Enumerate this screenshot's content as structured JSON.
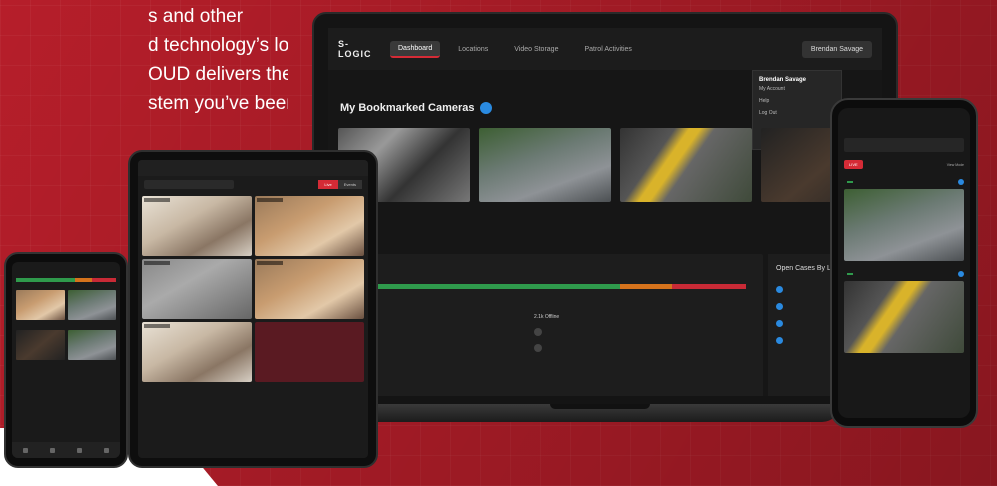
{
  "marketing": {
    "lines": [
      "s and other",
      "d technology’s low",
      "OUD delivers the",
      "stem you’ve been"
    ]
  },
  "colors": {
    "brand_red": "#b61e2a",
    "accent_red": "#d52b36",
    "online_green": "#2f9a4c",
    "warning_orange": "#d6731c",
    "info_blue": "#2a8ae0"
  },
  "laptop": {
    "nav": {
      "logo": "S-LOGIC",
      "items": [
        "Dashboard",
        "Locations",
        "Video Storage",
        "Patrol Activities"
      ],
      "user_chip": "Brendan Savage"
    },
    "user_menu": {
      "name": "Brendan Savage",
      "items": [
        "My Account",
        "Help",
        "Log Out"
      ]
    },
    "bookmarked_title": "My Bookmarked Cameras",
    "cameras": [
      {
        "label": "",
        "sub": "",
        "status": ""
      },
      {
        "label": "",
        "sub": "",
        "status": ""
      },
      {
        "label": "",
        "sub": "",
        "status": ""
      },
      {
        "label": "",
        "sub": "",
        "status": ""
      }
    ],
    "status_panel": {
      "offline_title": "2.1k Offline"
    },
    "side_panel": {
      "title": "Open Cases By Location"
    }
  },
  "tablet": {
    "toggle": [
      "Live",
      "Events"
    ]
  },
  "phone_right": {
    "loc": "",
    "live": "LIVE",
    "view_mode": "View Mode",
    "feeds": [
      {
        "name": "",
        "state": ""
      },
      {
        "name": "",
        "state": ""
      }
    ]
  }
}
